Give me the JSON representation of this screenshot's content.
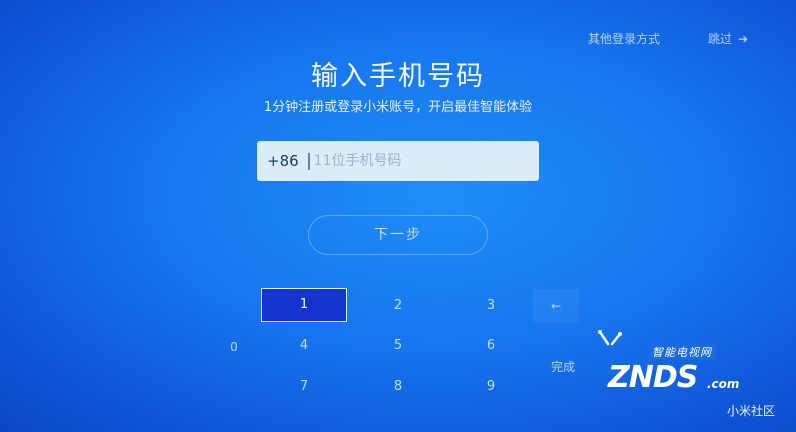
{
  "header": {
    "other_login": "其他登录方式",
    "skip": "跳过",
    "skip_arrow": "➔"
  },
  "title": "输入手机号码",
  "subtitle": "1分钟注册或登录小米账号，开启最佳智能体验",
  "phone": {
    "country_code": "+86",
    "value": "",
    "placeholder": "11位手机号码"
  },
  "next_label": "下一步",
  "keypad": {
    "k1": "1",
    "k2": "2",
    "k3": "3",
    "k4": "4",
    "k5": "5",
    "k6": "6",
    "k7": "7",
    "k8": "8",
    "k9": "9",
    "k0": "0",
    "delete": "←",
    "done": "完成",
    "selected_key": "1"
  },
  "watermark": {
    "tag": "智能电视网",
    "word": "ZNDS",
    "com": ".com",
    "community": "小米社区"
  },
  "colors": {
    "background": "#1676ee",
    "selected_key": "#1335cf",
    "input_background": "#dbecfb"
  }
}
